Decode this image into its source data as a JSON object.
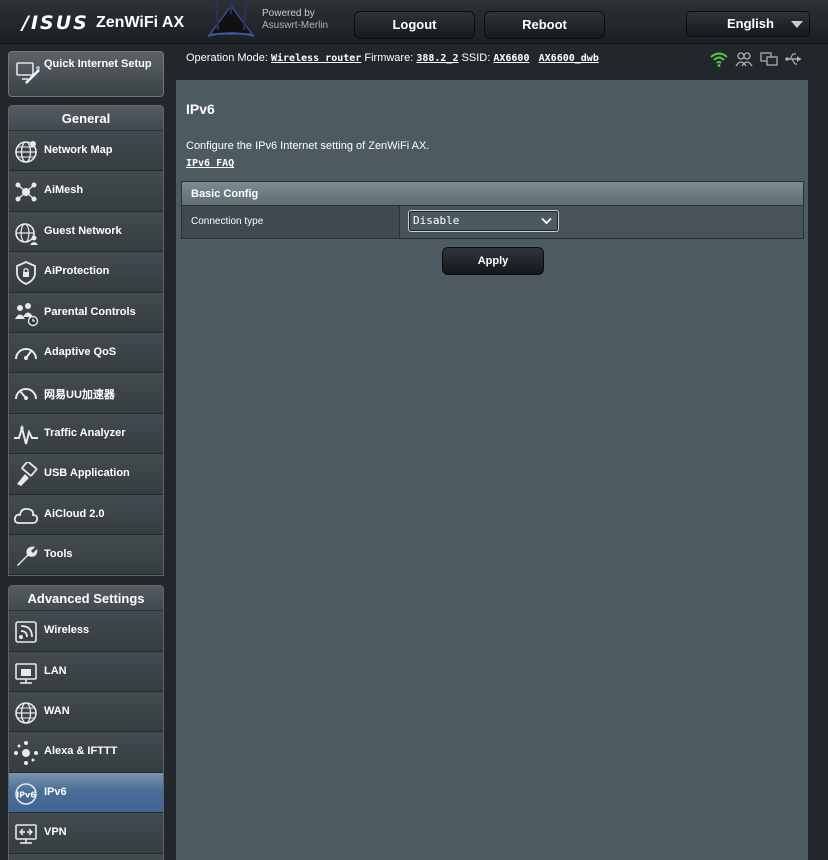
{
  "header": {
    "brand": "/ISUS",
    "model": "ZenWiFi AX",
    "powered_line1": "Powered by",
    "powered_line2": "Asuswrt-Merlin",
    "logout_label": "Logout",
    "reboot_label": "Reboot",
    "language": "English"
  },
  "sidebar": {
    "quick_setup_label": "Quick Internet Setup",
    "general_header": "General",
    "general_items": [
      {
        "label": "Network Map",
        "icon": "globe-icon"
      },
      {
        "label": "AiMesh",
        "icon": "mesh-icon"
      },
      {
        "label": "Guest Network",
        "icon": "guest-network-icon"
      },
      {
        "label": "AiProtection",
        "icon": "shield-icon"
      },
      {
        "label": "Parental Controls",
        "icon": "parental-controls-icon"
      },
      {
        "label": "Adaptive QoS",
        "icon": "gauge-icon"
      },
      {
        "label": "网易UU加速器",
        "icon": "uu-accelerator-icon"
      },
      {
        "label": "Traffic Analyzer",
        "icon": "traffic-analyzer-icon"
      },
      {
        "label": "USB Application",
        "icon": "usb-icon"
      },
      {
        "label": "AiCloud 2.0",
        "icon": "cloud-icon"
      },
      {
        "label": "Tools",
        "icon": "wrench-icon"
      }
    ],
    "advanced_header": "Advanced Settings",
    "advanced_items": [
      {
        "label": "Wireless",
        "icon": "wireless-icon"
      },
      {
        "label": "LAN",
        "icon": "lan-icon"
      },
      {
        "label": "WAN",
        "icon": "wan-globe-icon"
      },
      {
        "label": "Alexa & IFTTT",
        "icon": "alexa-icon"
      },
      {
        "label": "IPv6",
        "icon": "ipv6-icon",
        "active": true
      },
      {
        "label": "VPN",
        "icon": "vpn-icon"
      }
    ]
  },
  "status": {
    "op_mode_label": "Operation Mode:",
    "op_mode_value": "Wireless router",
    "firmware_label": "Firmware:",
    "firmware_value": "388.2_2",
    "ssid_label": "SSID:",
    "ssid_1": "AX6600",
    "ssid_2": "AX6600_dwb",
    "colors": {
      "wifi": "#4fd13b",
      "icon": "#a9b1b5"
    }
  },
  "main": {
    "title": "IPv6",
    "description": "Configure the IPv6 Internet setting of ZenWiFi AX.",
    "faq_link": "IPv6 FAQ",
    "section_title": "Basic Config",
    "connection_type_label": "Connection type",
    "connection_type_value": "Disable",
    "apply_label": "Apply"
  }
}
